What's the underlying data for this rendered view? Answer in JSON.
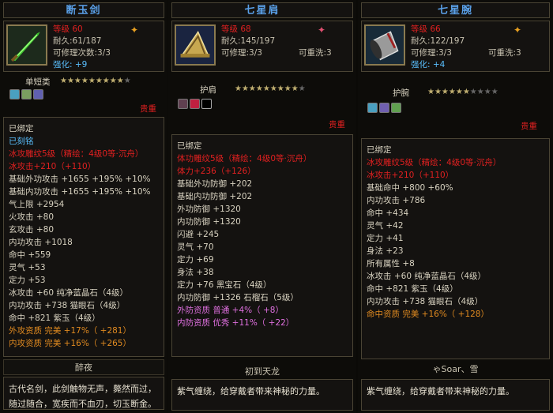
{
  "items": [
    {
      "title": "断玉剑",
      "stats": [
        "等级 60",
        "耐久:61/187",
        "可修理次数:3/3",
        "强化: +9"
      ],
      "type_label": "单短类",
      "value_label": "贵重",
      "lines": [
        {
          "t": "已绑定",
          "c": "white"
        },
        {
          "t": "已刻铭",
          "c": "blue"
        },
        {
          "t": "冰攻雕纹5级（精绘：4级0等·沉舟）",
          "c": "red"
        },
        {
          "t": "冰攻击+210（+110）",
          "c": "red"
        },
        {
          "t": "基础外功攻击 +1655 +195% +10%",
          "c": "white"
        },
        {
          "t": "基础内功攻击 +1655 +195% +10%",
          "c": "white"
        },
        {
          "t": "气上限 +2954",
          "c": "white"
        },
        {
          "t": "火攻击 +80",
          "c": "white"
        },
        {
          "t": "玄攻击 +80",
          "c": "white"
        },
        {
          "t": "内功攻击 +1018",
          "c": "white"
        },
        {
          "t": "命中 +559",
          "c": "white"
        },
        {
          "t": "灵气 +53",
          "c": "white"
        },
        {
          "t": "定力 +53",
          "c": "white"
        },
        {
          "t": "冰攻击 +60 纯净蓝晶石（4级）",
          "c": "white"
        },
        {
          "t": "内功攻击 +738 猫眼石（4级）",
          "c": "white"
        },
        {
          "t": "命中 +821 紫玉（4级）",
          "c": "white"
        },
        {
          "t": "外攻资质 完美 +17%（ +281）",
          "c": "orange"
        },
        {
          "t": "内攻资质 完美 +16%（ +265）",
          "c": "orange"
        }
      ],
      "footer_name": "醉夜",
      "desc": "古代名剑，此剑触物无声，斃然而过，随过随合，宽疾而不血刃，切玉断金。"
    },
    {
      "title": "七星肩",
      "stats": [
        "等级 68",
        "耐久:145/197",
        "可修理:3/3",
        "可重洗:3"
      ],
      "type_label": "护肩",
      "value_label": "贵重",
      "lines": [
        {
          "t": "已绑定",
          "c": "white"
        },
        {
          "t": "体功雕纹5级（精绘：4级0等·沉舟）",
          "c": "red"
        },
        {
          "t": "体力+236（+126）",
          "c": "red"
        },
        {
          "t": "基础外功防御 +202",
          "c": "white"
        },
        {
          "t": "基础内功防御 +202",
          "c": "white"
        },
        {
          "t": "外功防御 +1320",
          "c": "white"
        },
        {
          "t": "内功防御 +1320",
          "c": "white"
        },
        {
          "t": "闪避 +245",
          "c": "white"
        },
        {
          "t": "灵气 +70",
          "c": "white"
        },
        {
          "t": "定力 +69",
          "c": "white"
        },
        {
          "t": "身法 +38",
          "c": "white"
        },
        {
          "t": "定力 +76 黑宝石（4级）",
          "c": "white"
        },
        {
          "t": "内功防御 +1326 石榴石（5级）",
          "c": "white"
        },
        {
          "t": "外防资质 普通 +4%（ +8）",
          "c": "pink"
        },
        {
          "t": "内防资质 优秀 +11%（ +22）",
          "c": "pink"
        }
      ],
      "footer_name": "初到天龙",
      "desc": "紫气缠绕，给穿戴者带来神秘的力量。"
    },
    {
      "title": "七星腕",
      "stats": [
        "等级 66",
        "耐久:122/197",
        "可修理:3/3",
        "可重洗:3",
        "强化: +4"
      ],
      "type_label": "护腕",
      "value_label": "贵重",
      "lines": [
        {
          "t": "已绑定",
          "c": "white"
        },
        {
          "t": "冰攻雕纹5级（精绘：4级0等·沉舟）",
          "c": "red"
        },
        {
          "t": "冰攻击+210（+110）",
          "c": "red"
        },
        {
          "t": "基础命中 +800 +60%",
          "c": "white"
        },
        {
          "t": "内功攻击 +786",
          "c": "white"
        },
        {
          "t": "命中 +434",
          "c": "white"
        },
        {
          "t": "灵气 +42",
          "c": "white"
        },
        {
          "t": "定力 +41",
          "c": "white"
        },
        {
          "t": "身法 +23",
          "c": "white"
        },
        {
          "t": "所有属性 +8",
          "c": "white"
        },
        {
          "t": "冰攻击 +60 纯净蓝晶石（4级）",
          "c": "white"
        },
        {
          "t": "命中 +821 紫玉（4级）",
          "c": "white"
        },
        {
          "t": "内功攻击 +738 猫眼石（4级）",
          "c": "white"
        },
        {
          "t": "命中资质 完美 +16%（ +128）",
          "c": "orange"
        }
      ],
      "footer_name": "ゃSoar、雪",
      "desc": "紫气缠绕，给穿戴者带来神秘的力量。"
    }
  ],
  "colors": {
    "grade_red": "#e02020",
    "title_blue": "#5aa0e8",
    "attr_blue": "#5ac0ff",
    "quality_orange": "#e08a20",
    "quality_pink": "#e070e0"
  }
}
